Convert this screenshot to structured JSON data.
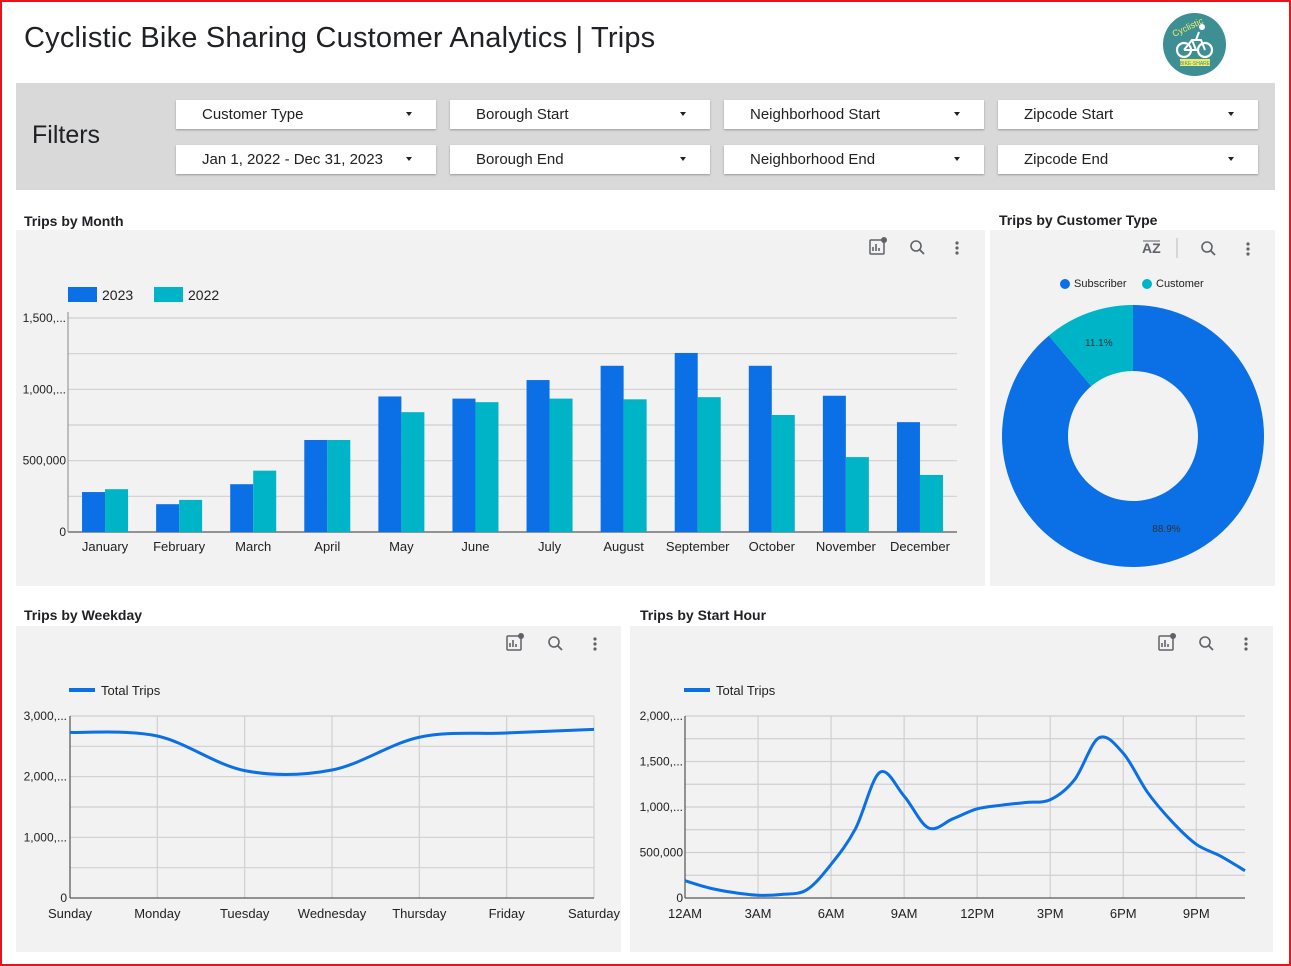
{
  "header": {
    "title": "Cyclistic Bike Sharing Customer Analytics  |  Trips",
    "logo_text_top": "Cyclistic",
    "logo_text_bottom": "BIKE-SHARE"
  },
  "filters": {
    "label": "Filters",
    "dropdowns": [
      {
        "label": "Customer Type"
      },
      {
        "label": "Borough Start"
      },
      {
        "label": "Neighborhood Start"
      },
      {
        "label": "Zipcode Start"
      },
      {
        "label": "Jan 1, 2022 - Dec 31, 2023"
      },
      {
        "label": "Borough End"
      },
      {
        "label": "Neighborhood End"
      },
      {
        "label": "Zipcode End"
      }
    ]
  },
  "colors": {
    "series_2023": "#0b6fe6",
    "series_2022": "#00b4c8",
    "frame": "#e8141a",
    "panel_bg": "#f2f2f2"
  },
  "chart_data": [
    {
      "id": "month",
      "type": "bar",
      "title": "Trips by Month",
      "categories": [
        "January",
        "February",
        "March",
        "April",
        "May",
        "June",
        "July",
        "August",
        "September",
        "October",
        "November",
        "December"
      ],
      "series": [
        {
          "name": "2023",
          "values": [
            280000,
            195000,
            335000,
            645000,
            950000,
            935000,
            1065000,
            1165000,
            1255000,
            1165000,
            955000,
            770000
          ]
        },
        {
          "name": "2022",
          "values": [
            300000,
            225000,
            430000,
            645000,
            840000,
            910000,
            935000,
            930000,
            945000,
            820000,
            525000,
            400000
          ]
        }
      ],
      "yticks": [
        "0",
        "500,000",
        "1,000,...",
        "1,500,..."
      ],
      "ylim": [
        0,
        1500000
      ],
      "legend": "top-left",
      "grid": true
    },
    {
      "id": "customer",
      "type": "pie",
      "title": "Trips by Customer Type",
      "labels": [
        "Subscriber",
        "Customer"
      ],
      "values": [
        88.9,
        11.1
      ],
      "value_labels": [
        "88.9%",
        "11.1%"
      ],
      "donut": true,
      "legend": "top"
    },
    {
      "id": "weekday",
      "type": "line",
      "title": "Trips by Weekday",
      "categories": [
        "Sunday",
        "Monday",
        "Tuesday",
        "Wednesday",
        "Thursday",
        "Friday",
        "Saturday"
      ],
      "series": [
        {
          "name": "Total Trips",
          "values": [
            2730000,
            2670000,
            2100000,
            2110000,
            2650000,
            2720000,
            2780000
          ]
        }
      ],
      "yticks": [
        "0",
        "1,000,...",
        "2,000,...",
        "3,000,..."
      ],
      "ylim": [
        0,
        3000000
      ],
      "legend": "top-left",
      "grid": true
    },
    {
      "id": "hour",
      "type": "line",
      "title": "Trips by Start Hour",
      "x": [
        0,
        1,
        2,
        3,
        4,
        5,
        6,
        7,
        8,
        9,
        10,
        11,
        12,
        13,
        14,
        15,
        16,
        17,
        18,
        19,
        20,
        21,
        22,
        23
      ],
      "xticks": [
        "12AM",
        "3AM",
        "6AM",
        "9AM",
        "12PM",
        "3PM",
        "6PM",
        "9PM"
      ],
      "series": [
        {
          "name": "Total Trips",
          "values": [
            190000,
            110000,
            60000,
            30000,
            40000,
            90000,
            370000,
            760000,
            1380000,
            1120000,
            770000,
            870000,
            980000,
            1020000,
            1050000,
            1080000,
            1300000,
            1760000,
            1590000,
            1160000,
            840000,
            590000,
            460000,
            300000
          ]
        }
      ],
      "yticks": [
        "0",
        "500,000",
        "1,000,...",
        "1,500,...",
        "2,000,..."
      ],
      "ylim": [
        0,
        2000000
      ],
      "legend": "top-left",
      "grid": true
    }
  ]
}
